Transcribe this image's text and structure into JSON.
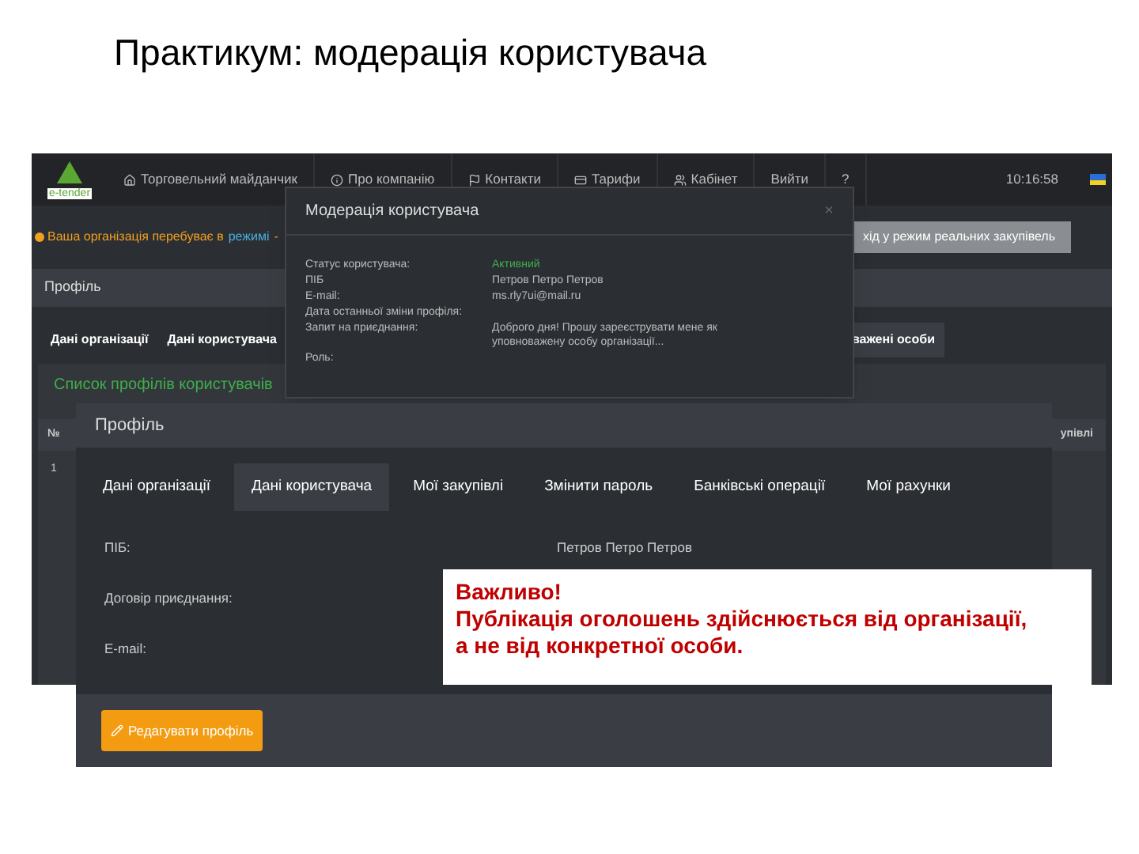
{
  "slide_title": "Практикум: модерація користувача",
  "back_screen": {
    "logo_text": "e-tender",
    "nav": [
      {
        "label": "Торговельний майданчик"
      },
      {
        "label": "Про компанію"
      },
      {
        "label": "Контакти"
      },
      {
        "label": "Тарифи"
      },
      {
        "label": "Кабінет"
      },
      {
        "label": "Вийти"
      },
      {
        "label": "?"
      }
    ],
    "time": "10:16:58",
    "notice": {
      "text": "Ваша організація перебуває в",
      "link": "режимі",
      "tail": "-"
    },
    "mode_button": "хід у режим реальних закупівель",
    "section_title": "Профіль",
    "tabs": [
      {
        "label": "Дані організації",
        "selected": false
      },
      {
        "label": "Дані користувача",
        "selected": false
      },
      {
        "label": "важені особи",
        "selected": true
      }
    ],
    "list_title": "Список профілів користувачів",
    "table": {
      "columns": [
        "№",
        "упівлі"
      ],
      "rows": [
        [
          "1"
        ]
      ]
    }
  },
  "modal": {
    "title": "Модерація користувача",
    "close": "×",
    "fields": [
      {
        "label": "Статус користувача:",
        "value": "Активний",
        "kind": "status"
      },
      {
        "label": "ПІБ",
        "value": "Петров Петро Петров",
        "kind": "text"
      },
      {
        "label": "E-mail:",
        "value": "ms.rly7ui@mail.ru",
        "kind": "text"
      },
      {
        "label": "Дата останньої зміни профіля:"
      },
      {
        "label": "Запит на приєднання:",
        "value": "Доброго дня! Прошу зареєструвати мене як уповноважену особу організації...",
        "kind": "text"
      },
      {
        "label": "Роль:"
      }
    ]
  },
  "front_screen": {
    "title": "Профіль",
    "tabs": [
      {
        "label": "Дані організації",
        "selected": false
      },
      {
        "label": "Дані користувача",
        "selected": true
      },
      {
        "label": "Мої закупівлі",
        "selected": false
      },
      {
        "label": "Змінити пароль",
        "selected": false
      },
      {
        "label": "Банківські операції",
        "selected": false
      },
      {
        "label": "Мої рахунки",
        "selected": false
      }
    ],
    "fields": [
      {
        "label": "ПІБ:",
        "value": "Петров Петро Петров"
      },
      {
        "label": "Договір приєднання:"
      },
      {
        "label": "E-mail:"
      }
    ],
    "edit_button": "Редагувати профіль"
  },
  "callout": {
    "title": "Важливо!",
    "text": "Публікація оголошень здійснюється від організації, а не від конкретної особи."
  }
}
